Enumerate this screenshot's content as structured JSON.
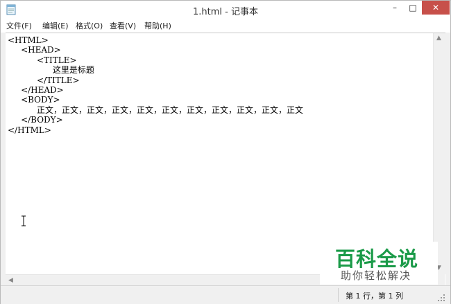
{
  "window": {
    "title": "1.html - 记事本",
    "controls": {
      "minimize": "–",
      "maximize": "□",
      "close": "✕"
    }
  },
  "menu": {
    "items": [
      {
        "label": "文件(F)"
      },
      {
        "label": "编辑(E)"
      },
      {
        "label": "格式(O)"
      },
      {
        "label": "查看(V)"
      },
      {
        "label": "帮助(H)"
      }
    ]
  },
  "editor": {
    "lines": [
      "<HTML>",
      "     <HEAD>",
      "           <TITLE>",
      "                 这里是标题",
      "           </TITLE>",
      "     </HEAD>",
      "     <BODY>",
      "           正文，正文，正文，正文，正文，正文，正文，正文，正文，正文，正文",
      "     </BODY>",
      "</HTML>"
    ]
  },
  "status": {
    "position": "第 1 行，第 1 列"
  },
  "watermark": {
    "main": "百科全说",
    "sub": "助你轻松解决"
  },
  "icons": {
    "app": "notepad-icon",
    "cursor": "text-cursor-icon",
    "grip": "resize-grip-icon"
  }
}
